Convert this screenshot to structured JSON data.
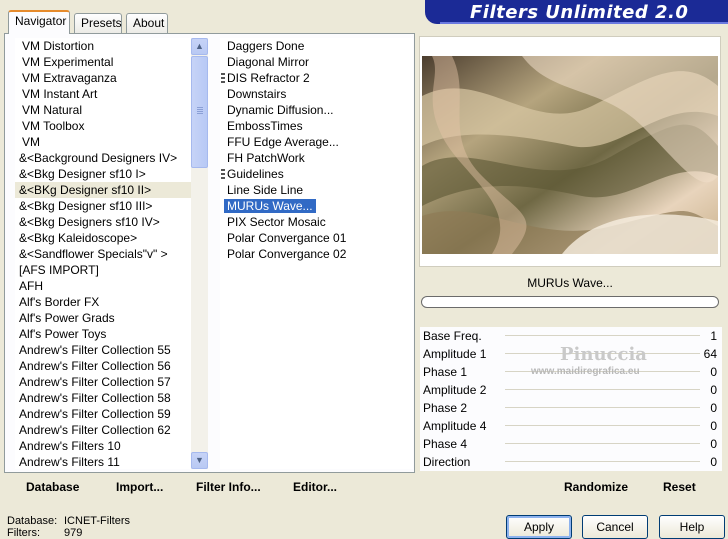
{
  "tabs": [
    "Navigator",
    "Presets",
    "About"
  ],
  "banner_title": "Filters Unlimited 2.0",
  "categories": [
    "VM Distortion",
    "VM Experimental",
    "VM Extravaganza",
    "VM Instant Art",
    "VM Natural",
    "VM Toolbox",
    "VM",
    "&<Background Designers IV>",
    "&<Bkg Designer sf10 I>",
    "&<BKg Designer sf10 II>",
    "&<Bkg Designer sf10 III>",
    "&<Bkg Designers sf10 IV>",
    "&<Bkg Kaleidoscope>",
    "&<Sandflower Specials\"v\" >",
    "[AFS IMPORT]",
    "AFH",
    "Alf's Border FX",
    "Alf's Power Grads",
    "Alf's Power Toys",
    "Andrew's Filter Collection 55",
    "Andrew's Filter Collection 56",
    "Andrew's Filter Collection 57",
    "Andrew's Filter Collection 58",
    "Andrew's Filter Collection 59",
    "Andrew's Filter Collection 62",
    "Andrew's Filters 10",
    "Andrew's Filters 11"
  ],
  "selected_category": "&<BKg Designer sf10 II>",
  "filters": [
    "Daggers Done",
    "Diagonal Mirror",
    "DIS Refractor 2",
    "Downstairs",
    "Dynamic Diffusion...",
    "EmbossTimes",
    "FFU Edge Average...",
    "FH PatchWork",
    "Guidelines",
    "Line Side Line",
    "MURUs Wave...",
    "PIX Sector Mosaic",
    "Polar Convergance 01",
    "Polar Convergance 02"
  ],
  "selected_filter": "MURUs Wave...",
  "bottom_buttons": [
    "Database",
    "Import...",
    "Filter Info...",
    "Editor..."
  ],
  "filter_name": "MURUs Wave...",
  "params": [
    {
      "label": "Base Freq.",
      "value": "1"
    },
    {
      "label": "Amplitude 1",
      "value": "64"
    },
    {
      "label": "Phase 1",
      "value": "0"
    },
    {
      "label": "Amplitude 2",
      "value": "0"
    },
    {
      "label": "Phase 2",
      "value": "0"
    },
    {
      "label": "Amplitude 4",
      "value": "0"
    },
    {
      "label": "Phase 4",
      "value": "0"
    },
    {
      "label": "Direction",
      "value": "0"
    }
  ],
  "watermark": {
    "name": "Pinuccia",
    "url": "www.maidiregrafica.eu"
  },
  "randomize_label": "Randomize",
  "reset_label": "Reset",
  "db_info": {
    "database_label": "Database:",
    "database_value": "ICNET-Filters",
    "filters_label": "Filters:",
    "filters_value": "979"
  },
  "apply_label": "Apply",
  "cancel_label": "Cancel",
  "help_label": "Help"
}
